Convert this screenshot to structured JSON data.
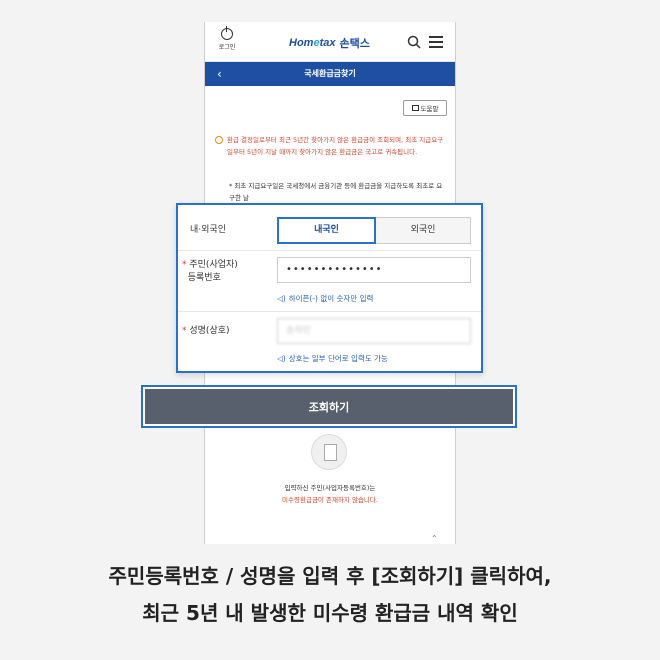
{
  "topbar": {
    "login_label": "로그인",
    "logo_brand_a": "Hom",
    "logo_brand_e": "e",
    "logo_brand_b": "tax",
    "logo_name": "손택스"
  },
  "header": {
    "title": "국세환급금찾기"
  },
  "help_button": {
    "label": "도움말"
  },
  "notice": {
    "text": "환급 결정일로부터 최근 5년간 찾아가지 않은 환급금이 조회되며, 최초 지급요구일부터 5년이 지날 때까지 찾아가지 않은 환급금은 국고로 귀속됩니다.",
    "detail": "* 최초 지급요구일은 국세청에서 금융기관 등에 환급금을 지급하도록 최초로 요구한 날"
  },
  "form": {
    "nationality_label": "내·외국인",
    "domestic_tab": "내국인",
    "foreign_tab": "외국인",
    "id_label_1": "주민(사업자)",
    "id_label_2": "등록번호",
    "id_value": "••••••••••••••",
    "id_hint": "하이픈(-) 없이 숫자만 입력",
    "name_label": "성명(상호)",
    "name_value": "송하민",
    "name_hint": "상호는 일부 단어로 입력도 가능"
  },
  "query_button": {
    "label": "조회하기"
  },
  "result": {
    "line1": "입력하신 주민(사업자등록번호)는",
    "line2": "미수령환급금이 존재하지 않습니다."
  },
  "caption": {
    "line1": "주민등록번호 / 성명을 입력 후 [조회하기] 클릭하여,",
    "line2": "최근 5년 내 발생한 미수령 환급금 내역 확인"
  },
  "colors": {
    "brand": "#1e4fa0",
    "accent": "#2a72c9",
    "alert": "#d2442c",
    "button": "#58606d"
  },
  "icons": [
    "power-icon",
    "search-icon",
    "menu-icon",
    "back-icon",
    "book-icon",
    "info-icon",
    "speaker-icon",
    "document-icon",
    "chevron-up-icon"
  ]
}
